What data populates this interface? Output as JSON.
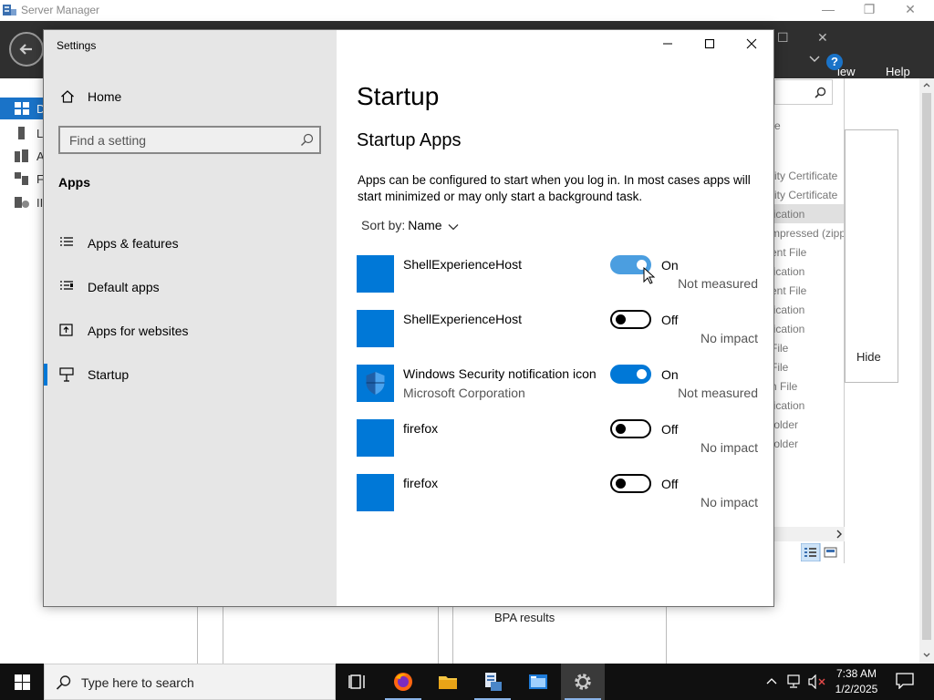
{
  "server_manager": {
    "title": "Server Manager",
    "menu_view": "iew",
    "menu_help": "Help",
    "sidebar": [
      {
        "label": "D",
        "active": true
      },
      {
        "label": "L",
        "active": false
      },
      {
        "label": "A",
        "active": false
      },
      {
        "label": "F",
        "active": false
      },
      {
        "label": "II",
        "active": false
      }
    ],
    "right_list": [
      "rity Certificate",
      "rity Certificate",
      "lication",
      "mpressed (zipp...",
      "ent File",
      "lication",
      "ent File",
      "lication",
      "lication",
      "File",
      "File",
      "n File",
      "lication",
      "folder",
      "folder"
    ],
    "hide_label": "Hide",
    "bpa_label": "BPA results",
    "colors": {
      "header": "#2f2f2f",
      "accent": "#1a73c8"
    }
  },
  "settings": {
    "window_title": "Settings",
    "home_label": "Home",
    "search_placeholder": "Find a setting",
    "section_label": "Apps",
    "nav": [
      {
        "label": "Apps & features",
        "icon": "list-icon"
      },
      {
        "label": "Default apps",
        "icon": "default-apps-icon"
      },
      {
        "label": "Apps for websites",
        "icon": "open-in-app-icon"
      },
      {
        "label": "Startup",
        "icon": "startup-icon",
        "active": true
      }
    ],
    "page_title": "Startup",
    "section_title": "Startup Apps",
    "description": "Apps can be configured to start when you log in. In most cases apps will start minimized or may only start a background task.",
    "sort_label": "Sort by:",
    "sort_value": "Name",
    "apps": [
      {
        "name": "ShellExperienceHost",
        "publisher": "",
        "state": "On",
        "impact": "Not measured",
        "on": true
      },
      {
        "name": "ShellExperienceHost",
        "publisher": "",
        "state": "Off",
        "impact": "No impact",
        "on": false
      },
      {
        "name": "Windows Security notification icon",
        "publisher": "Microsoft Corporation",
        "state": "On",
        "impact": "Not measured",
        "on": true
      },
      {
        "name": "firefox",
        "publisher": "",
        "state": "Off",
        "impact": "No impact",
        "on": false
      },
      {
        "name": "firefox",
        "publisher": "",
        "state": "Off",
        "impact": "No impact",
        "on": false
      }
    ],
    "colors": {
      "accent": "#0078d7",
      "left_pane": "#e6e6e6"
    }
  },
  "taskbar": {
    "search_placeholder": "Type here to search",
    "time": "7:38 AM",
    "date": "1/2/2025",
    "apps": [
      "task-view-icon",
      "firefox-icon",
      "file-explorer-icon",
      "server-manager-icon",
      "windows-explorer-icon",
      "settings-gear-icon"
    ]
  }
}
